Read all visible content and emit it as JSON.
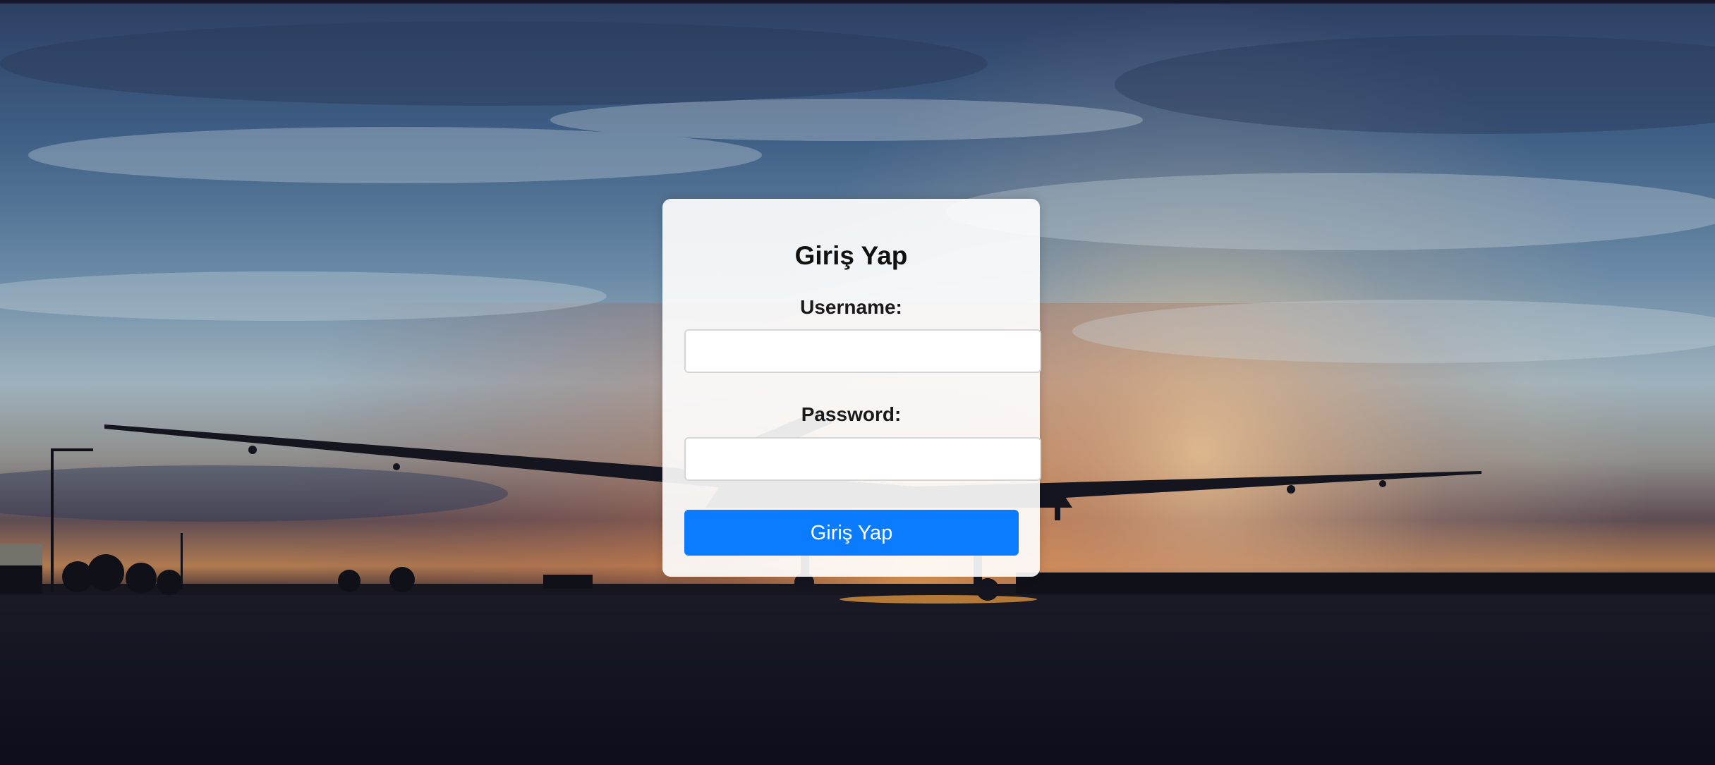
{
  "login_form": {
    "title": "Giriş Yap",
    "username_label": "Username:",
    "username_value": "",
    "password_label": "Password:",
    "password_value": "",
    "submit_label": "Giriş Yap"
  },
  "colors": {
    "primary_button": "#0b7cff",
    "card_background": "#ffffff",
    "page_background": "#0f1120"
  },
  "background_image": "sunset-airfield-aircraft-silhouette"
}
